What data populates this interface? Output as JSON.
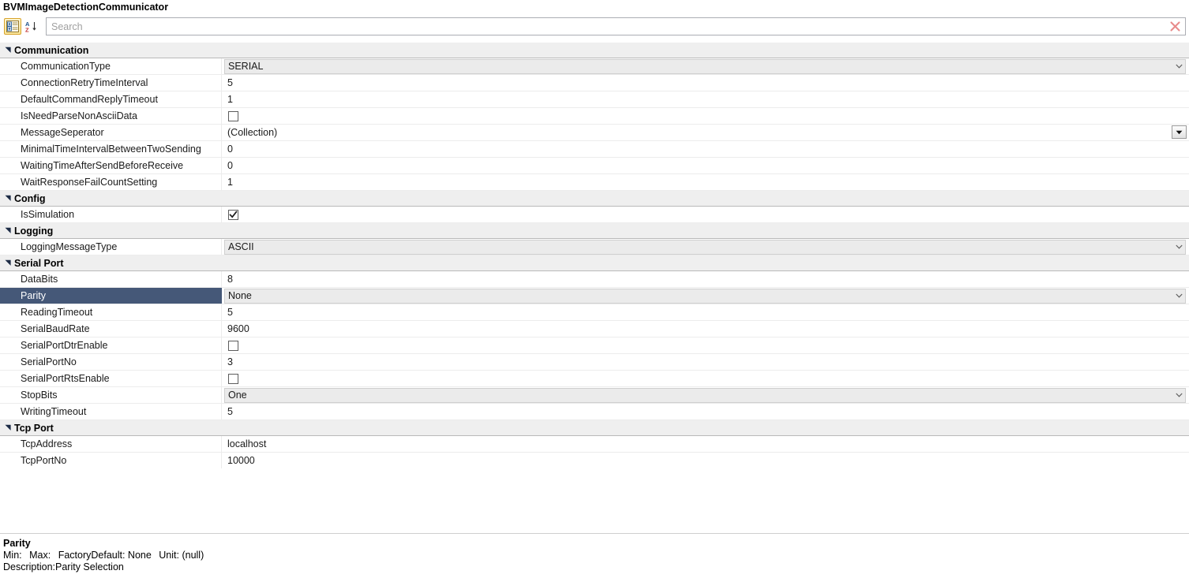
{
  "window": {
    "title": "BVMImageDetectionCommunicator"
  },
  "toolbar": {
    "categorized_button": {
      "name": "categorized-view-button",
      "selected": true
    },
    "alphabetical_button": {
      "name": "alphabetical-sort-button",
      "selected": false
    },
    "search": {
      "placeholder": "Search",
      "value": "",
      "clear_label": "✕"
    }
  },
  "grid": {
    "categories": [
      {
        "label": "Communication",
        "expanded": true,
        "properties": [
          {
            "name": "CommunicationType",
            "value": "SERIAL",
            "editor": "combo",
            "selected": false
          },
          {
            "name": "ConnectionRetryTimeInterval",
            "value": "5",
            "editor": "text",
            "selected": false
          },
          {
            "name": "DefaultCommandReplyTimeout",
            "value": "1",
            "editor": "text",
            "selected": false
          },
          {
            "name": "IsNeedParseNonAsciiData",
            "value": "",
            "editor": "checkbox",
            "checked": false,
            "selected": false
          },
          {
            "name": "MessageSeperator",
            "value": "(Collection)",
            "editor": "dropbutton",
            "selected": false
          },
          {
            "name": "MinimalTimeIntervalBetweenTwoSending",
            "value": "0",
            "editor": "text",
            "selected": false
          },
          {
            "name": "WaitingTimeAfterSendBeforeReceive",
            "value": "0",
            "editor": "text",
            "selected": false
          },
          {
            "name": "WaitResponseFailCountSetting",
            "value": "1",
            "editor": "text",
            "selected": false
          }
        ]
      },
      {
        "label": "Config",
        "expanded": true,
        "properties": [
          {
            "name": "IsSimulation",
            "value": "",
            "editor": "checkbox",
            "checked": true,
            "selected": false
          }
        ]
      },
      {
        "label": "Logging",
        "expanded": true,
        "properties": [
          {
            "name": "LoggingMessageType",
            "value": "ASCII",
            "editor": "combo",
            "selected": false
          }
        ]
      },
      {
        "label": "Serial Port",
        "expanded": true,
        "properties": [
          {
            "name": "DataBits",
            "value": "8",
            "editor": "text",
            "selected": false
          },
          {
            "name": "Parity",
            "value": "None",
            "editor": "combo",
            "selected": true
          },
          {
            "name": "ReadingTimeout",
            "value": "5",
            "editor": "text",
            "selected": false
          },
          {
            "name": "SerialBaudRate",
            "value": "9600",
            "editor": "text",
            "selected": false
          },
          {
            "name": "SerialPortDtrEnable",
            "value": "",
            "editor": "checkbox",
            "checked": false,
            "selected": false
          },
          {
            "name": "SerialPortNo",
            "value": "3",
            "editor": "text",
            "selected": false
          },
          {
            "name": "SerialPortRtsEnable",
            "value": "",
            "editor": "checkbox",
            "checked": false,
            "selected": false
          },
          {
            "name": "StopBits",
            "value": "One",
            "editor": "combo",
            "selected": false
          },
          {
            "name": "WritingTimeout",
            "value": "5",
            "editor": "text",
            "selected": false
          }
        ]
      },
      {
        "label": "Tcp Port",
        "expanded": true,
        "properties": [
          {
            "name": "TcpAddress",
            "value": "localhost",
            "editor": "text",
            "selected": false
          },
          {
            "name": "TcpPortNo",
            "value": "10000",
            "editor": "text",
            "selected": false
          }
        ]
      }
    ]
  },
  "description": {
    "title": "Parity",
    "min_label": "Min:",
    "max_label": "Max:",
    "factory_default_label": "FactoryDefault: None",
    "unit_label": "Unit: (null)",
    "description_line": "Description:Parity Selection"
  },
  "colors": {
    "selection": "#455878",
    "category_header": "#efefef",
    "combo_cell": "#ebebeb",
    "clear_icon": "#e88b8b",
    "toolbar_selected_border": "#d8a32a"
  }
}
